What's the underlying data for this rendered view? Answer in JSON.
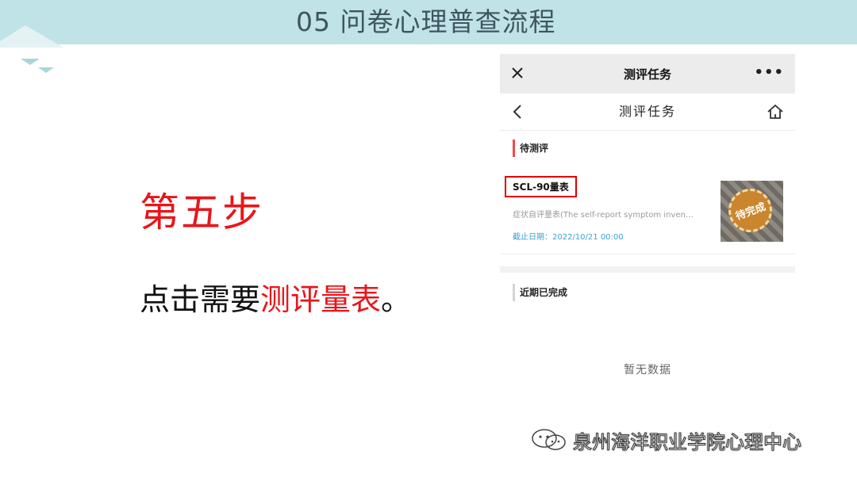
{
  "slide": {
    "title": "05 问卷心理普查流程",
    "step_title": "第五步",
    "step_desc_prefix": "点击需要",
    "step_desc_highlight": "测评量表",
    "step_desc_suffix": "。"
  },
  "phone": {
    "wechat_title": "测评任务",
    "nav_title": "测评任务",
    "pending_section": "待测评",
    "task": {
      "name": "SCL-90量表",
      "description": "症状自评量表(The self-report symptom invent…",
      "deadline": "截止日期：2022/10/21 00:00",
      "stamp": "待完成"
    },
    "completed_section": "近期已完成",
    "empty_text": "暂无数据"
  },
  "watermark": {
    "text": "泉州海洋职业学院心理中心"
  },
  "colors": {
    "accent_red": "#e8161b",
    "header_bg": "#bfe3e7",
    "deadline_blue": "#3aa0d8"
  }
}
